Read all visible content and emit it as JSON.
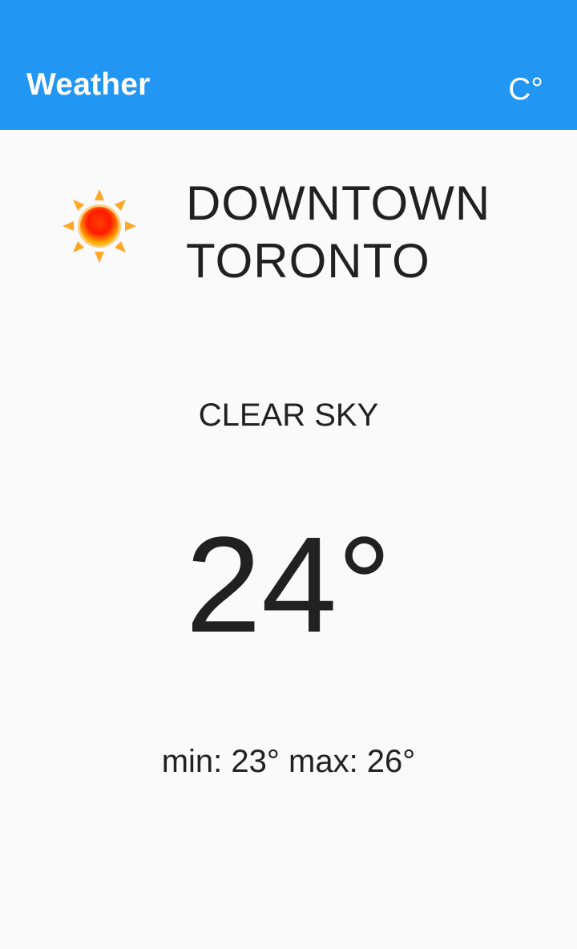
{
  "app_bar": {
    "title": "Weather",
    "unit_toggle": "C°",
    "color": "#2196f3"
  },
  "weather": {
    "icon": "sun-icon",
    "location": "DOWNTOWN TORONTO",
    "condition": "CLEAR SKY",
    "temperature": "24°",
    "min_max": "min: 23° max: 26°"
  }
}
